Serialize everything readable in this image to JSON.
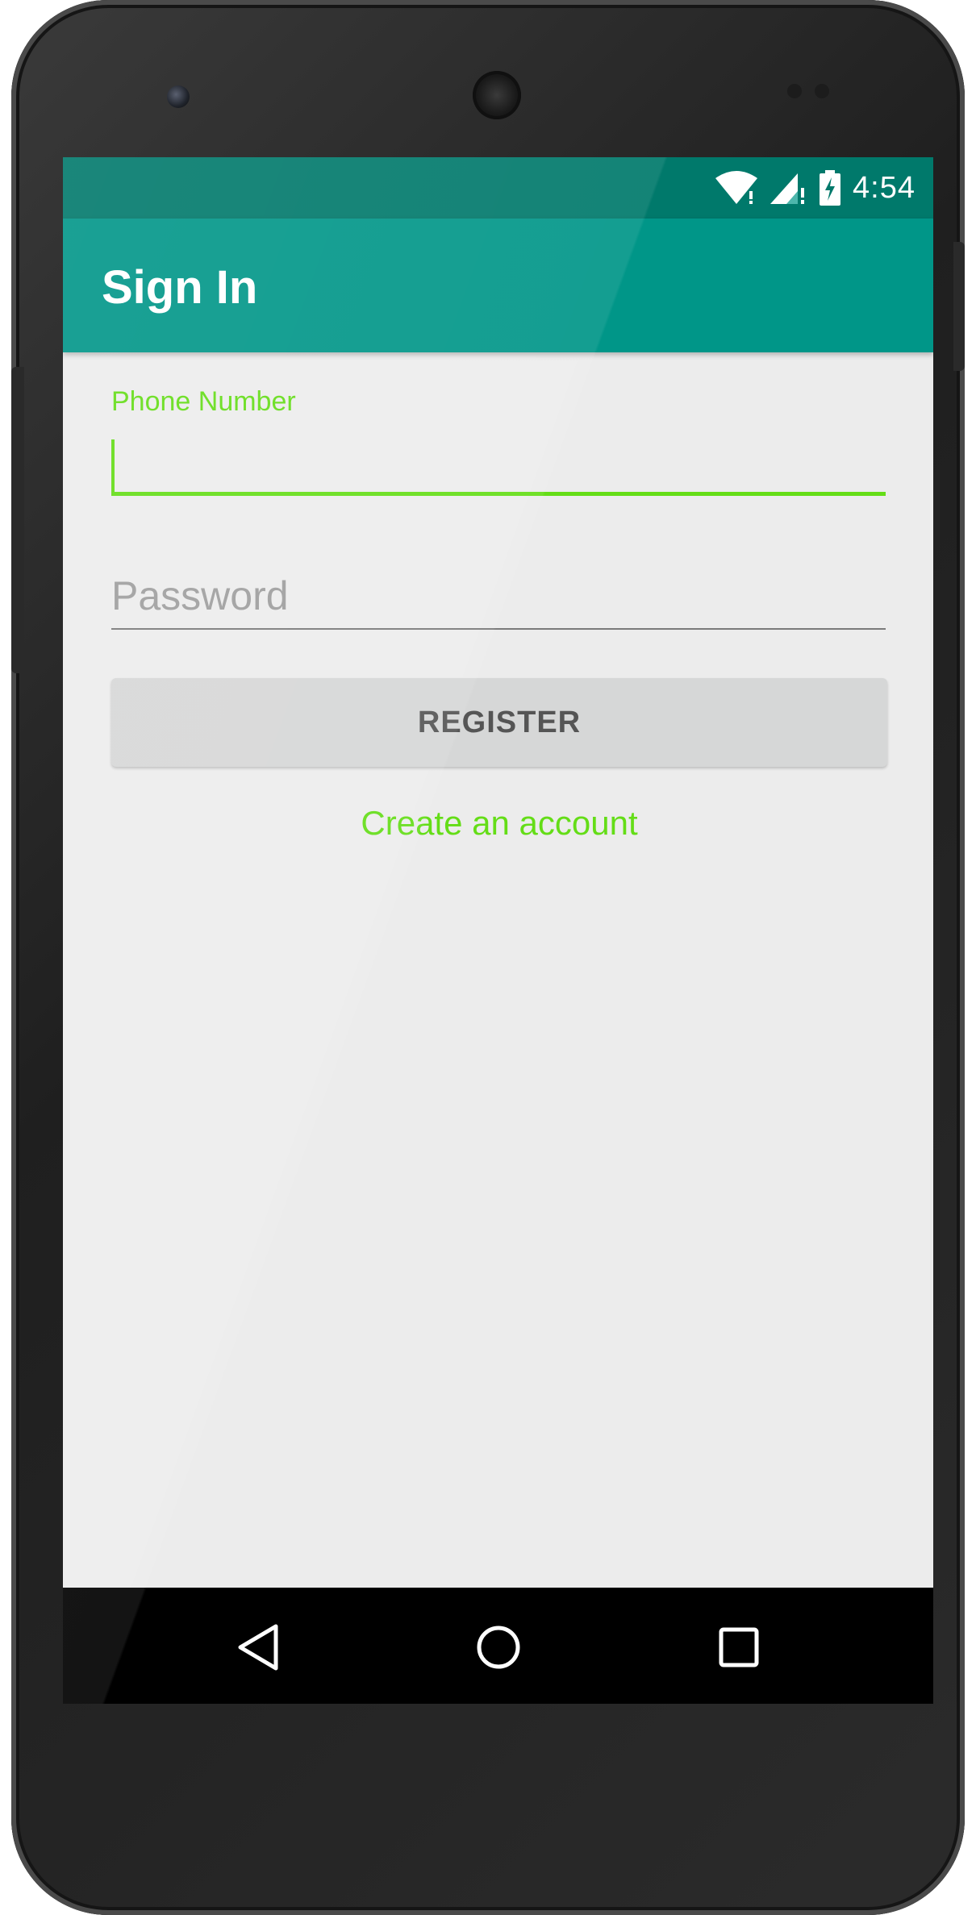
{
  "status_bar": {
    "time": "4:54",
    "icons": [
      "wifi-icon",
      "cell-signal-icon",
      "battery-charging-icon"
    ]
  },
  "toolbar": {
    "title": "Sign In"
  },
  "form": {
    "phone_label": "Phone Number",
    "phone_value": "",
    "password_placeholder": "Password",
    "password_value": "",
    "register_label": "REGISTER",
    "create_account_label": "Create an account"
  },
  "navigation": {
    "back": "back-icon",
    "home": "home-icon",
    "recents": "recents-icon"
  },
  "colors": {
    "accent": "#64dd17",
    "primary": "#009688",
    "primary_dark": "#00796b",
    "background": "#ececec",
    "button": "#d6d7d7"
  }
}
